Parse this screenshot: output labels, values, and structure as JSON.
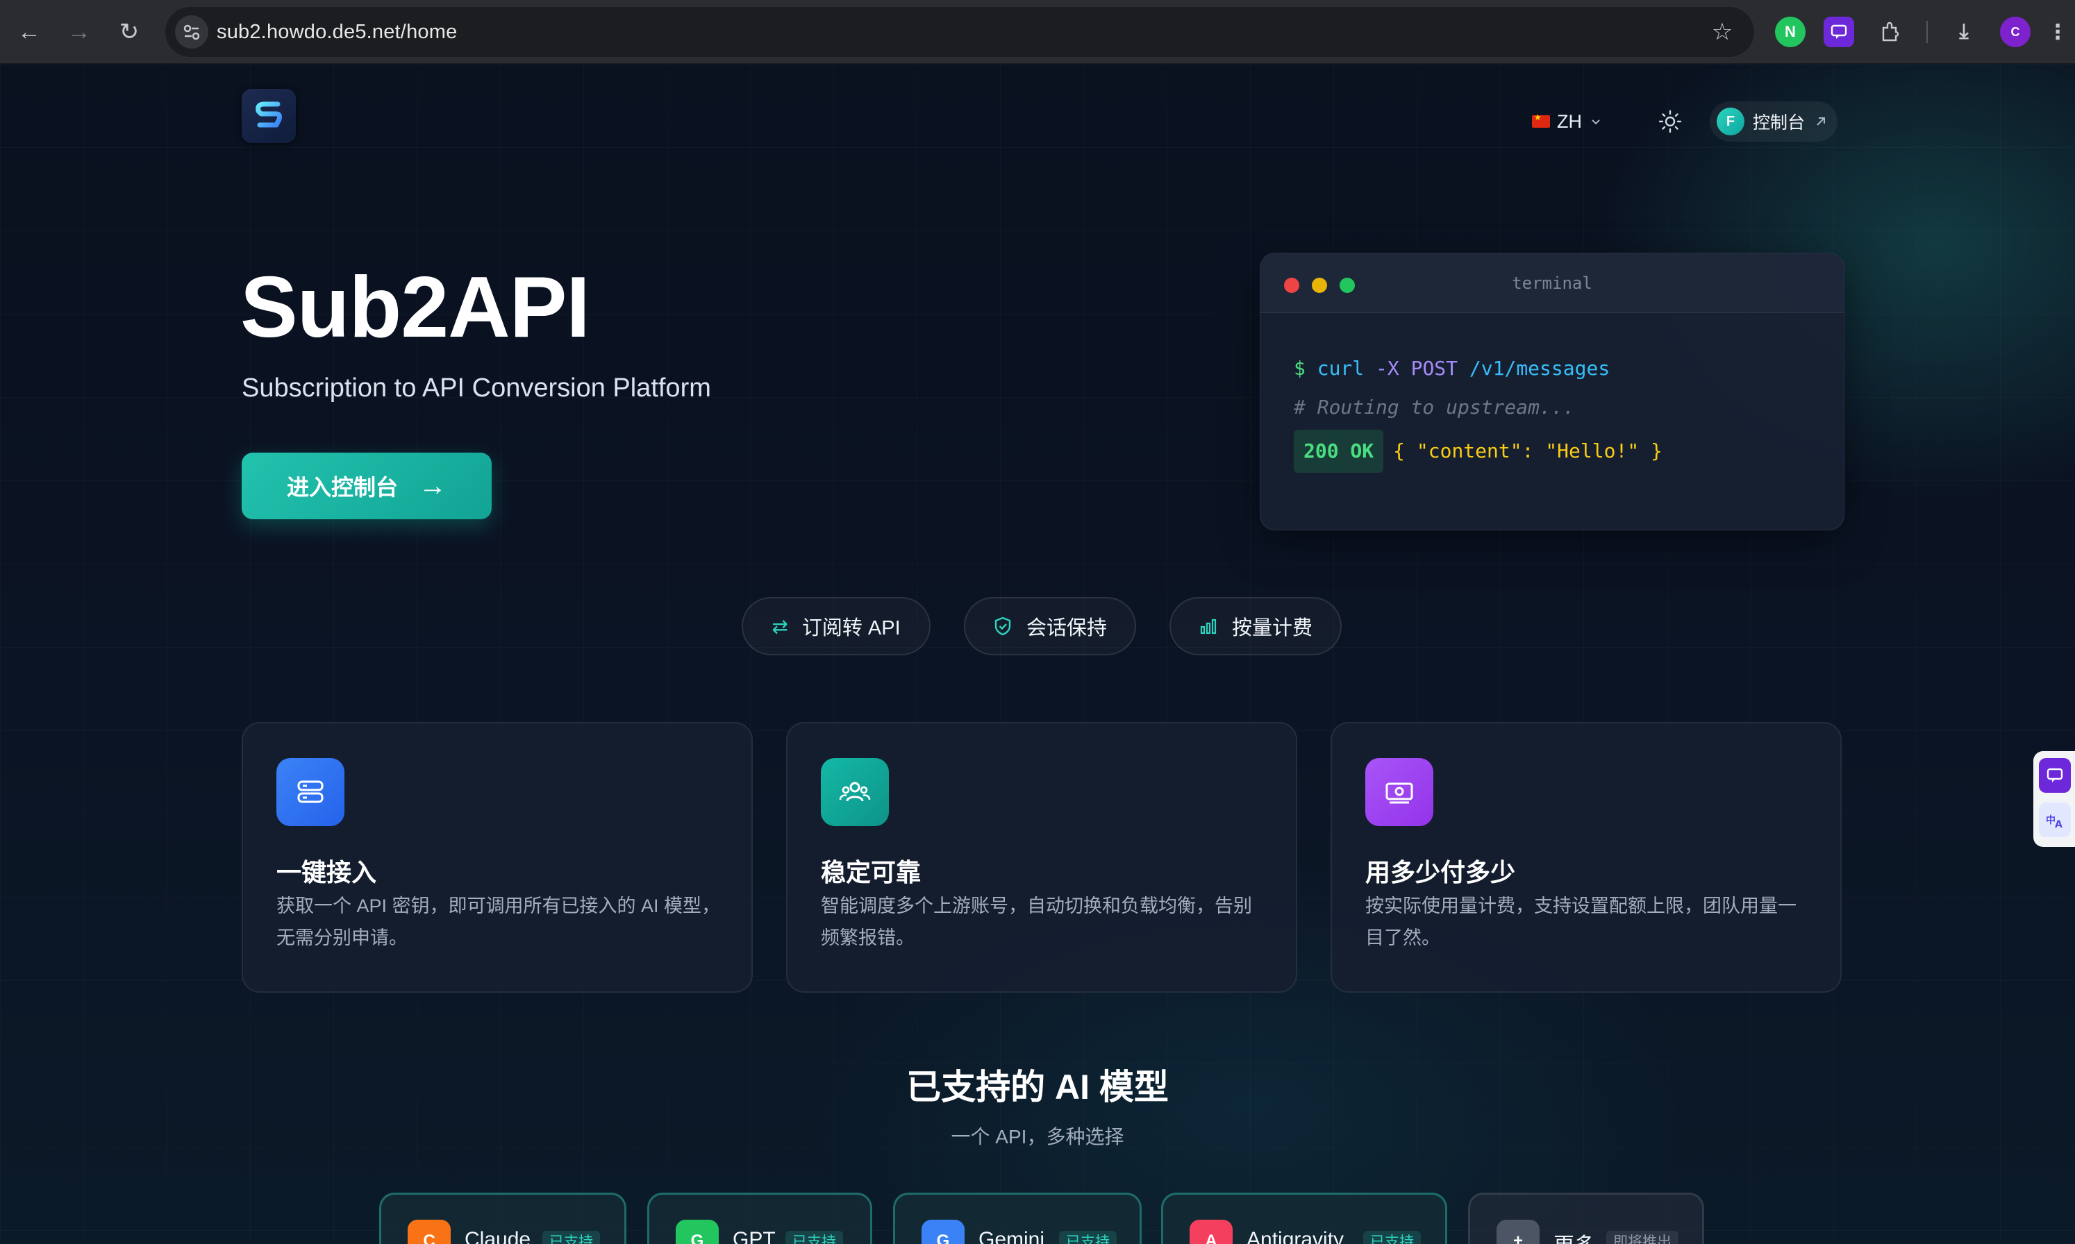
{
  "browser": {
    "url": "sub2.howdo.de5.net/home",
    "profile_initial": "C"
  },
  "nav": {
    "lang_label": "ZH",
    "console_avatar": "F",
    "console_label": "控制台"
  },
  "hero": {
    "title": "Sub2API",
    "subtitle": "Subscription to API Conversion Platform",
    "cta_label": "进入控制台"
  },
  "terminal": {
    "title": "terminal",
    "prompt": "$",
    "cmd": "curl",
    "flag": "-X",
    "method": "POST",
    "path": "/v1/messages",
    "comment": "# Routing to upstream...",
    "status": "200 OK",
    "brace_open": "{",
    "key": "\"content\"",
    "colon": ":",
    "value": "\"Hello!\"",
    "brace_close": "}"
  },
  "pills": [
    {
      "label": "订阅转 API",
      "icon": "swap-icon"
    },
    {
      "label": "会话保持",
      "icon": "shield-icon"
    },
    {
      "label": "按量计费",
      "icon": "bar-chart-icon"
    }
  ],
  "features": [
    {
      "title": "一键接入",
      "desc": "获取一个 API 密钥，即可调用所有已接入的 AI 模型，无需分别申请。",
      "icon": "server-icon",
      "color": "#3b82f6"
    },
    {
      "title": "稳定可靠",
      "desc": "智能调度多个上游账号，自动切换和负载均衡，告别频繁报错。",
      "icon": "users-icon",
      "color": "#14b8a6"
    },
    {
      "title": "用多少付多少",
      "desc": "按实际使用量计费，支持设置配额上限，团队用量一目了然。",
      "icon": "money-icon",
      "color": "#a855f7"
    }
  ],
  "models_section": {
    "title": "已支持的 AI 模型",
    "subtitle": "一个 API，多种选择"
  },
  "models": [
    {
      "initial": "C",
      "name": "Claude",
      "badge": "已支持",
      "color": "#f97316"
    },
    {
      "initial": "G",
      "name": "GPT",
      "badge": "已支持",
      "color": "#22c55e"
    },
    {
      "initial": "G",
      "name": "Gemini",
      "badge": "已支持",
      "color": "#3b82f6"
    },
    {
      "initial": "A",
      "name": "Antigravity",
      "badge": "已支持",
      "color": "#f43f5e"
    },
    {
      "initial": "+",
      "name": "更多",
      "badge": "即将推出",
      "color": "#4b5563"
    }
  ]
}
